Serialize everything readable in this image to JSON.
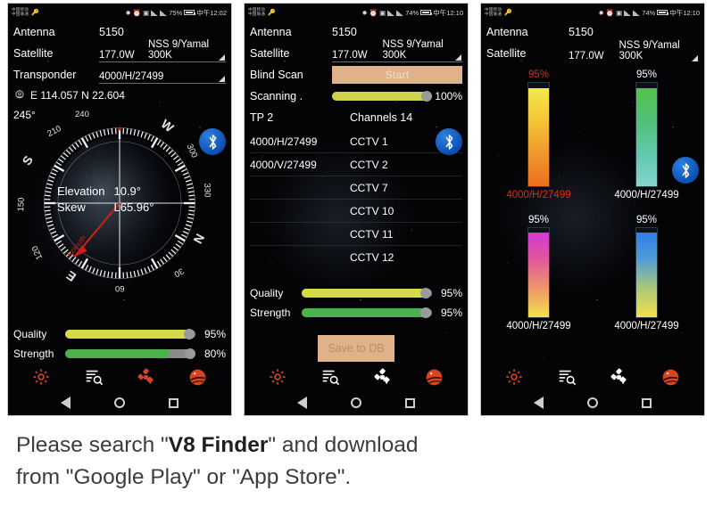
{
  "panels": [
    {
      "status": {
        "carrier_line1": "中国移动",
        "carrier_line2": "中国联通",
        "battery": "75%",
        "time": "中午12:02"
      },
      "rows": {
        "antenna_label": "Antenna",
        "antenna_value": "5150",
        "satellite_label": "Satellite",
        "satellite_orbit": "177.0W",
        "satellite_name": "NSS 9/Yamal 300K",
        "transponder_label": "Transponder",
        "transponder_value": "4000/H/27499",
        "location": "E 114.057 N 22.604"
      },
      "compass": {
        "azimuth_label": "245°",
        "ticks": [
          "240",
          "W",
          "300",
          "330",
          "N",
          "30",
          "60",
          "E",
          "120",
          "150",
          "S",
          "210"
        ],
        "elevation_label": "Elevation",
        "elevation_value": "10.9°",
        "skew_label": "Skew",
        "skew_value": "L65.96°",
        "arrow_label": "Azimuth"
      },
      "meters": [
        {
          "label": "Quality",
          "value": "95%",
          "pct": 95,
          "color": "#d6d94a"
        },
        {
          "label": "Strength",
          "value": "80%",
          "pct": 80,
          "color": "#4cb04c"
        }
      ],
      "nav": [
        {
          "name": "gear-icon",
          "color": "#d8441f"
        },
        {
          "name": "list-search-icon",
          "color": "#ffffff"
        },
        {
          "name": "satellite-icon",
          "color": "#d8441f"
        },
        {
          "name": "globe-icon",
          "color": "#d8441f"
        }
      ]
    },
    {
      "status": {
        "carrier_line1": "中国移动",
        "carrier_line2": "中国联通",
        "battery": "74%",
        "time": "中午12:10"
      },
      "rows": {
        "antenna_label": "Antenna",
        "antenna_value": "5150",
        "satellite_label": "Satellite",
        "satellite_orbit": "177.0W",
        "satellite_name": "NSS 9/Yamal 300K",
        "blind_scan_label": "Blind Scan",
        "start_button": "Start",
        "scanning_label": "Scanning .",
        "scanning_value": "100%",
        "scanning_pct": 100,
        "tp_label": "TP 2",
        "channels_label": "Channels 14"
      },
      "channels": [
        {
          "tp": "4000/H/27499",
          "name": "CCTV 1"
        },
        {
          "tp": "4000/V/27499",
          "name": "CCTV 2"
        },
        {
          "tp": "",
          "name": "CCTV 7"
        },
        {
          "tp": "",
          "name": "CCTV 10"
        },
        {
          "tp": "",
          "name": "CCTV 11"
        },
        {
          "tp": "",
          "name": "CCTV 12"
        }
      ],
      "meters": [
        {
          "label": "Quality",
          "value": "95%",
          "pct": 95,
          "color": "#d6d94a"
        },
        {
          "label": "Strength",
          "value": "95%",
          "pct": 95,
          "color": "#4cb04c"
        }
      ],
      "save_button": "Save to DB",
      "nav": [
        {
          "name": "gear-icon",
          "color": "#d8441f"
        },
        {
          "name": "list-search-icon",
          "color": "#ffffff"
        },
        {
          "name": "satellite-icon",
          "color": "#ffffff"
        },
        {
          "name": "globe-icon",
          "color": "#d8441f"
        }
      ]
    },
    {
      "status": {
        "carrier_line1": "中国移动",
        "carrier_line2": "中国联通",
        "battery": "74%",
        "time": "中午12:10"
      },
      "rows": {
        "antenna_label": "Antenna",
        "antenna_value": "5150",
        "satellite_label": "Satellite",
        "satellite_orbit": "177.0W",
        "satellite_name": "NSS 9/Yamal 300K"
      },
      "gauges": [
        {
          "pct_label": "95%",
          "pct": 95,
          "caption": "4000/H/27499",
          "text_color": "#e02b18",
          "gradient": "linear-gradient(to bottom, #f5e84a 0%, #f3c93a 30%, #f09a2c 65%, #ec6f1c 100%)"
        },
        {
          "pct_label": "95%",
          "pct": 95,
          "caption": "4000/H/27499",
          "text_color": "#ffffff",
          "gradient": "linear-gradient(to bottom, #53c24a 0%, #52c07a 35%, #63c9b0 70%, #86d6cd 100%)"
        },
        {
          "pct_label": "95%",
          "pct": 95,
          "caption": "4000/H/27499",
          "text_color": "#ffffff",
          "gradient": "linear-gradient(to bottom, #d43ad4 0%, #e0559f 30%, #ec8f6e 62%, #f3e14a 100%)"
        },
        {
          "pct_label": "95%",
          "pct": 95,
          "caption": "4000/H/27499",
          "text_color": "#ffffff",
          "gradient": "linear-gradient(to bottom, #2f7fe8 0%, #4f9ad8 30%, #a8c77a 65%, #f3e14a 100%)"
        }
      ],
      "nav": [
        {
          "name": "gear-icon",
          "color": "#d8441f"
        },
        {
          "name": "list-search-icon",
          "color": "#ffffff"
        },
        {
          "name": "satellite-icon",
          "color": "#ffffff"
        },
        {
          "name": "globe-icon",
          "color": "#d8441f"
        }
      ]
    }
  ],
  "caption": {
    "part1": "Please search \"",
    "bold": "V8 Finder",
    "part2": "\" and download",
    "line2": "from \"Google Play\" or \"App Store\"."
  }
}
